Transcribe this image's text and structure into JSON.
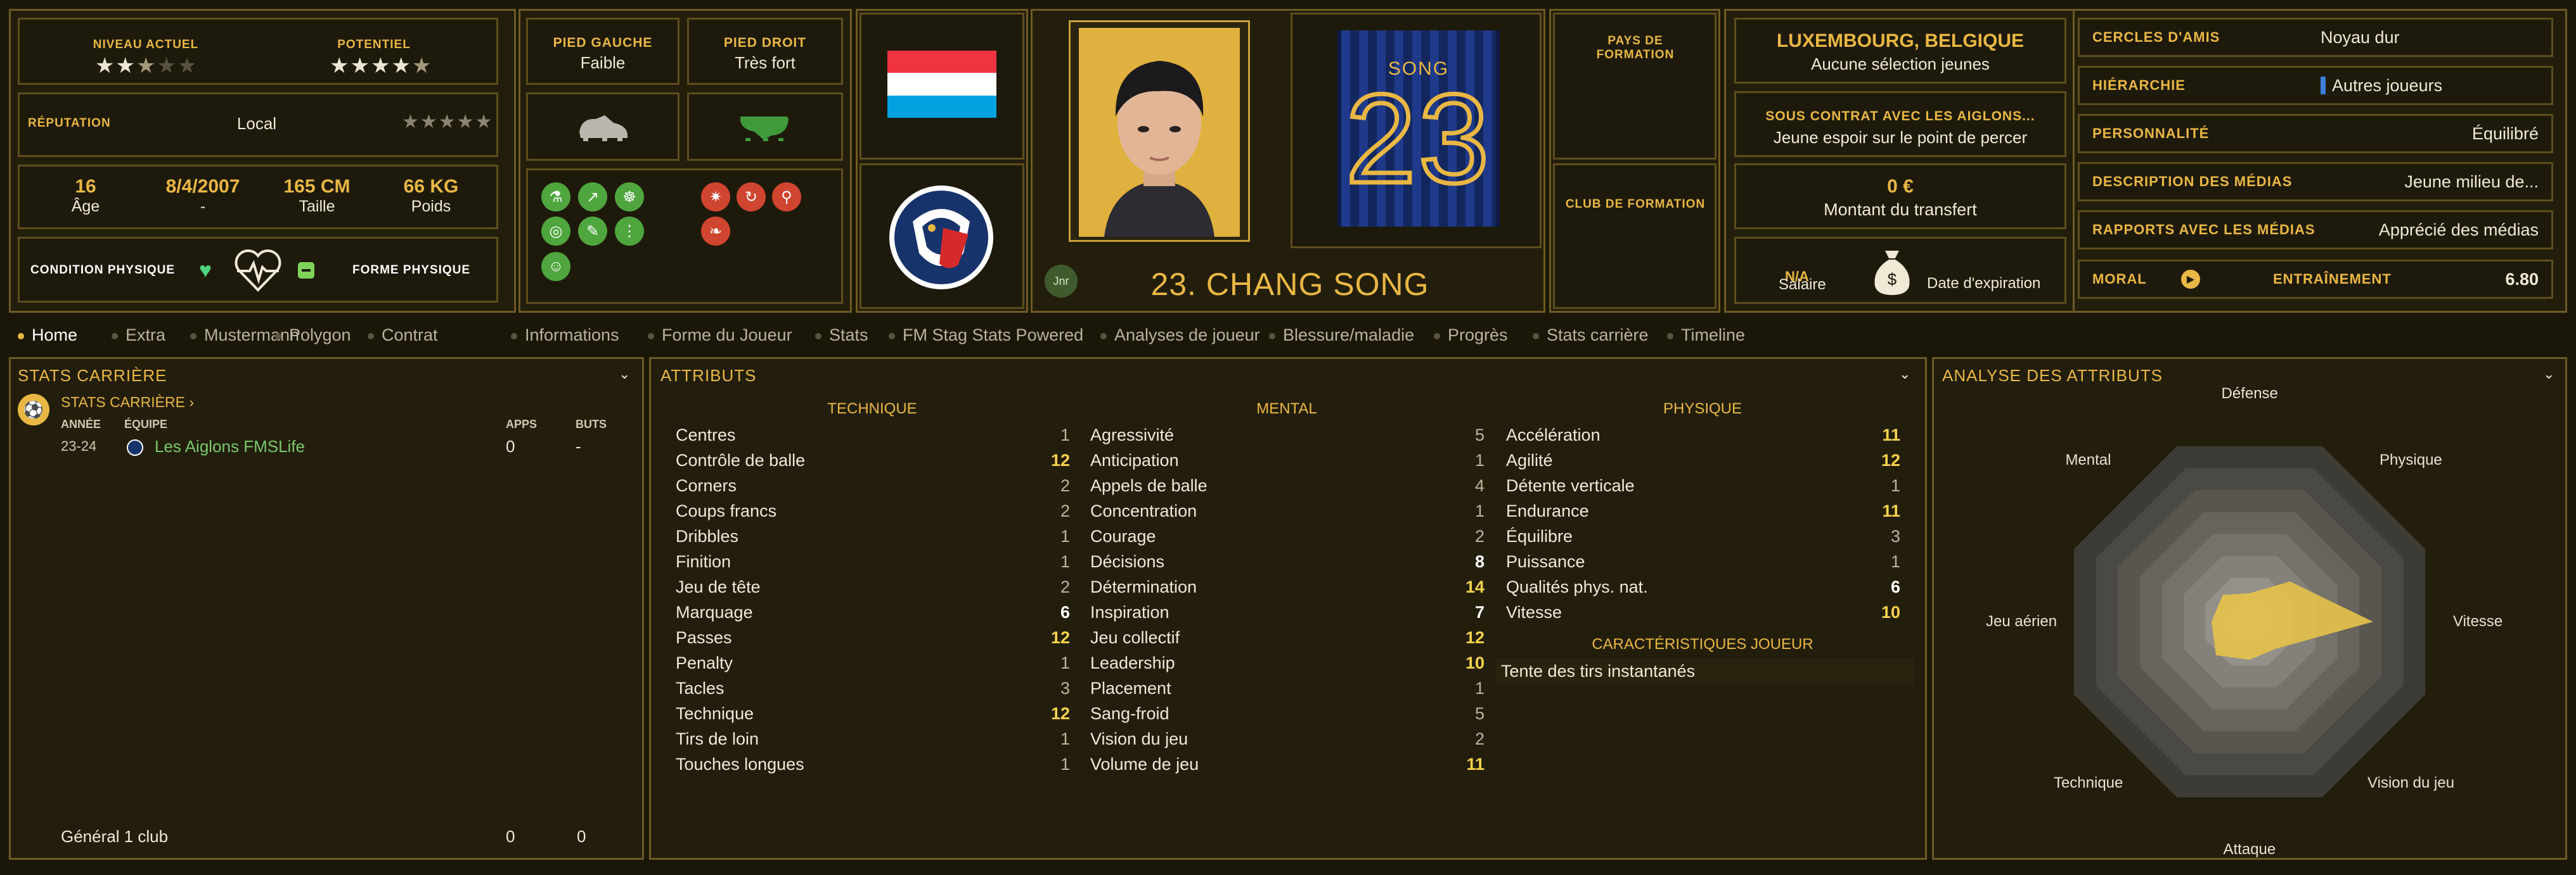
{
  "top": {
    "current_level_label": "NIVEAU ACTUEL",
    "current_level_stars": 2.5,
    "potential_label": "POTENTIEL",
    "potential_stars": 4.5,
    "reputation_label": "RÉPUTATION",
    "reputation_value": "Local",
    "reputation_stars": 0,
    "age_value": "16",
    "age_label": "Âge",
    "dob_value": "8/4/2007",
    "dob_label": "-",
    "height_value": "165 CM",
    "height_label": "Taille",
    "weight_value": "66 KG",
    "weight_label": "Poids",
    "condition_label": "CONDITION PHYSIQUE",
    "form_label": "FORME PHYSIQUE",
    "left_foot_label": "PIED GAUCHE",
    "left_foot_value": "Faible",
    "right_foot_label": "PIED DROIT",
    "right_foot_value": "Très fort",
    "nation_formation_label": "PAYS DE FORMATION",
    "club_formation_label": "CLUB DE FORMATION",
    "nationality": "LUXEMBOURG, BELGIQUE",
    "youth_caps": "Aucune sélection jeunes",
    "contract_label": "SOUS CONTRAT AVEC LES AIGLONS...",
    "contract_value": "Jeune espoir sur le point de percer",
    "transfer_value": "0 €",
    "transfer_label": "Montant du transfert",
    "salary_value": "N/A",
    "salary_label": "Salaire",
    "expiry_label": "Date d'expiration",
    "badge_jnr": "Jnr",
    "player_name": "23. CHANG SONG",
    "shirt_name": "SONG",
    "shirt_number": "23"
  },
  "info": {
    "friends_label": "CERCLES D'AMIS",
    "friends_value": "Noyau dur",
    "hierarchy_label": "HIÉRARCHIE",
    "hierarchy_value": "Autres joueurs",
    "personality_label": "PERSONNALITÉ",
    "personality_value": "Équilibré",
    "media_desc_label": "DESCRIPTION DES MÉDIAS",
    "media_desc_value": "Jeune milieu de...",
    "media_rel_label": "RAPPORTS AVEC LES MÉDIAS",
    "media_rel_value": "Apprécié des médias",
    "morale_label": "MORAL",
    "training_label": "ENTRAÎNEMENT",
    "training_value": "6.80"
  },
  "tabs": [
    "Home",
    "Extra",
    "Mustermann",
    "Polygon",
    "Contrat",
    "Informations",
    "Forme du Joueur",
    "Stats",
    "FM Stag Stats Powered",
    "Analyses de joueur",
    "Blessure/maladie",
    "Progrès",
    "Stats carrière",
    "Timeline"
  ],
  "career": {
    "title": "STATS CARRIÈRE",
    "subtitle": "STATS CARRIÈRE",
    "col_year": "ANNÉE",
    "col_team": "ÉQUIPE",
    "col_apps": "APPS",
    "col_goals": "BUTS",
    "row_year": "23-24",
    "row_team": "Les Aiglons FMSLife",
    "row_apps": "0",
    "row_goals": "-",
    "total_label": "Général 1 club",
    "total_apps": "0",
    "total_goals": "0"
  },
  "attributes": {
    "title": "ATTRIBUTS",
    "technical_label": "TECHNIQUE",
    "mental_label": "MENTAL",
    "physical_label": "PHYSIQUE",
    "traits_label": "CARACTÉRISTIQUES JOUEUR",
    "trait_1": "Tente des tirs instantanés",
    "technical": [
      {
        "name": "Centres",
        "value": "1"
      },
      {
        "name": "Contrôle de balle",
        "value": "12"
      },
      {
        "name": "Corners",
        "value": "2"
      },
      {
        "name": "Coups francs",
        "value": "2"
      },
      {
        "name": "Dribbles",
        "value": "1"
      },
      {
        "name": "Finition",
        "value": "1"
      },
      {
        "name": "Jeu de tête",
        "value": "2"
      },
      {
        "name": "Marquage",
        "value": "6"
      },
      {
        "name": "Passes",
        "value": "12"
      },
      {
        "name": "Penalty",
        "value": "1"
      },
      {
        "name": "Tacles",
        "value": "3"
      },
      {
        "name": "Technique",
        "value": "12"
      },
      {
        "name": "Tirs de loin",
        "value": "1"
      },
      {
        "name": "Touches longues",
        "value": "1"
      }
    ],
    "mental": [
      {
        "name": "Agressivité",
        "value": "5"
      },
      {
        "name": "Anticipation",
        "value": "1"
      },
      {
        "name": "Appels de balle",
        "value": "4"
      },
      {
        "name": "Concentration",
        "value": "1"
      },
      {
        "name": "Courage",
        "value": "2"
      },
      {
        "name": "Décisions",
        "value": "8"
      },
      {
        "name": "Détermination",
        "value": "14"
      },
      {
        "name": "Inspiration",
        "value": "7"
      },
      {
        "name": "Jeu collectif",
        "value": "12"
      },
      {
        "name": "Leadership",
        "value": "10"
      },
      {
        "name": "Placement",
        "value": "1"
      },
      {
        "name": "Sang-froid",
        "value": "5"
      },
      {
        "name": "Vision du jeu",
        "value": "2"
      },
      {
        "name": "Volume de jeu",
        "value": "11"
      }
    ],
    "physical": [
      {
        "name": "Accélération",
        "value": "11"
      },
      {
        "name": "Agilité",
        "value": "12"
      },
      {
        "name": "Détente verticale",
        "value": "1"
      },
      {
        "name": "Endurance",
        "value": "11"
      },
      {
        "name": "Équilibre",
        "value": "3"
      },
      {
        "name": "Puissance",
        "value": "1"
      },
      {
        "name": "Qualités phys. nat.",
        "value": "6"
      },
      {
        "name": "Vitesse",
        "value": "10"
      }
    ]
  },
  "analysis": {
    "title": "ANALYSE DES ATTRIBUTS",
    "axes": [
      "Défense",
      "Physique",
      "Vitesse",
      "Vision du jeu",
      "Attaque",
      "Technique",
      "Jeu aérien",
      "Mental"
    ],
    "values": [
      3,
      6,
      13,
      4,
      4,
      5,
      4,
      4
    ],
    "max": 20
  },
  "colors": {
    "accent": "#e9b744",
    "panel": "#231e0c",
    "border": "#6e5b22",
    "radar_fill": "#e7c24a"
  }
}
